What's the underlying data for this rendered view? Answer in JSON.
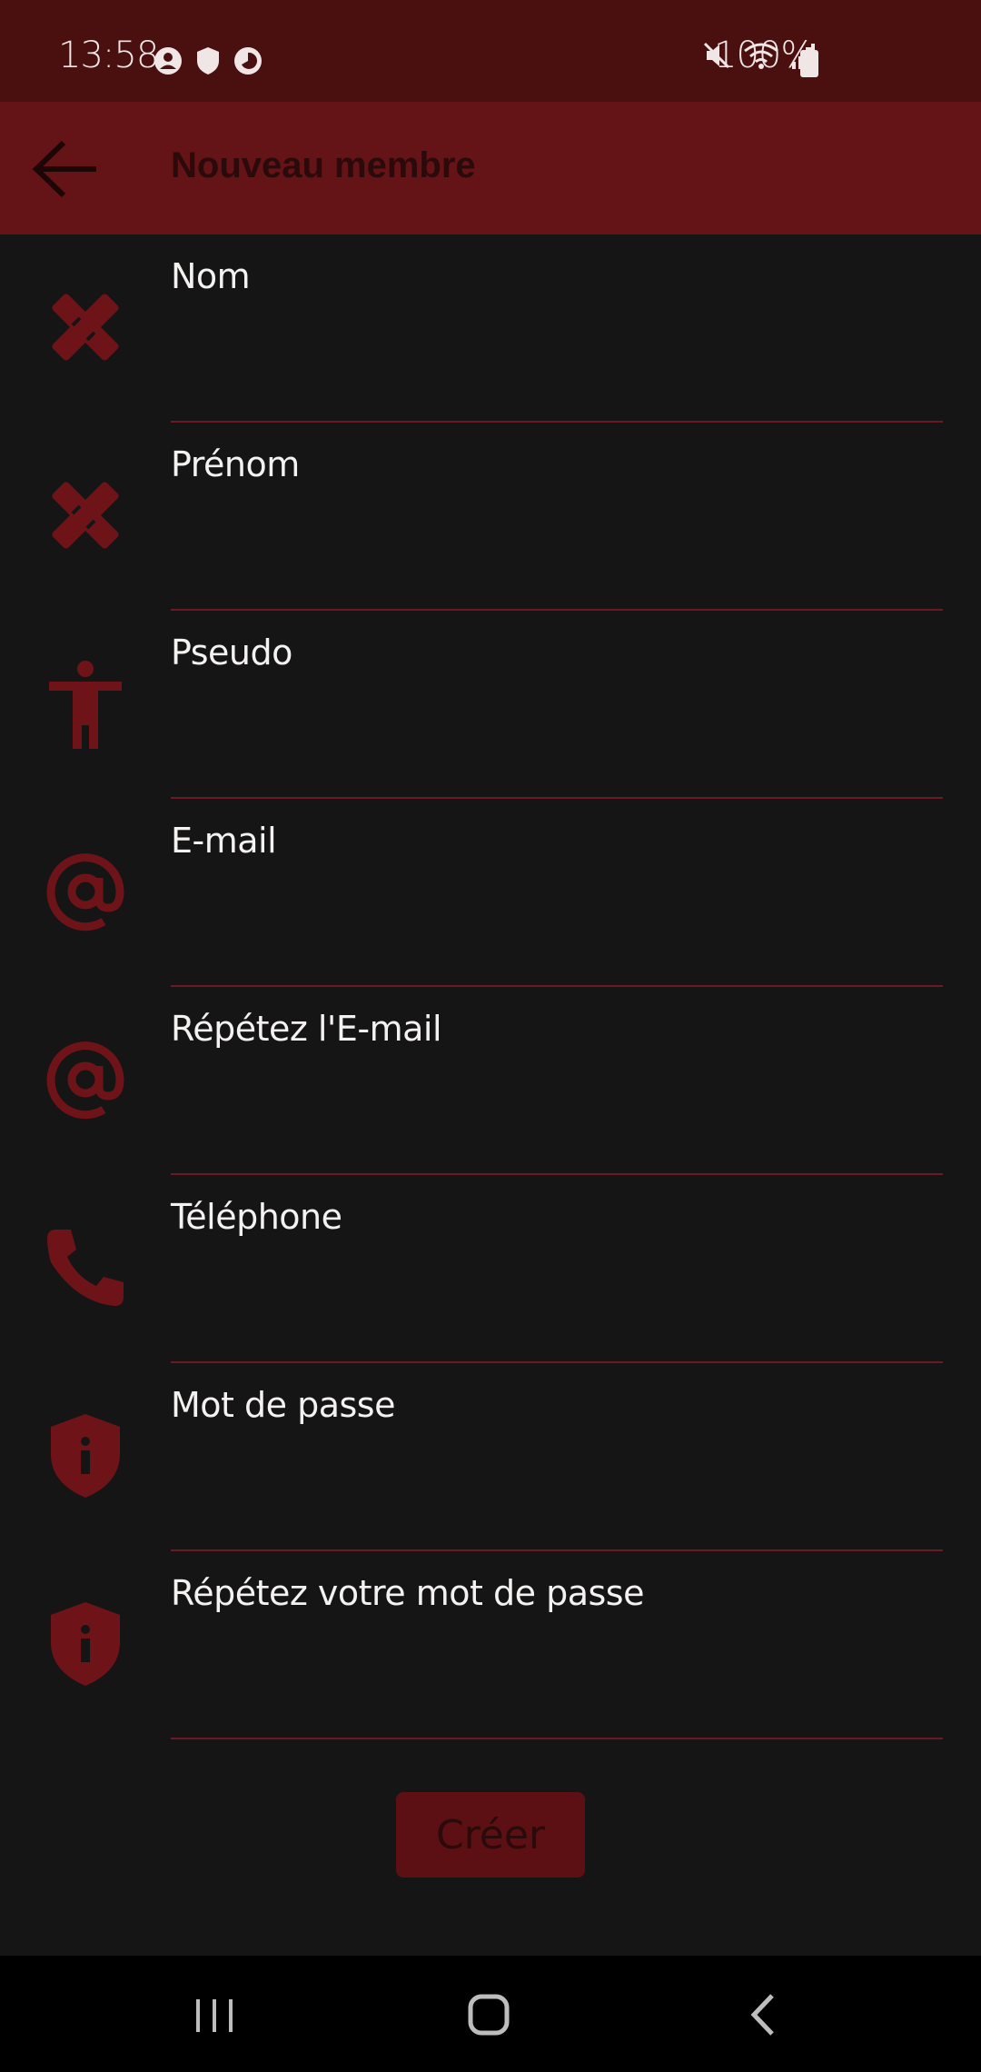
{
  "status_bar": {
    "time": "13:58",
    "battery_text": "100%",
    "left_icons": [
      "account-circle-icon",
      "shield-icon",
      "vpn-shield-icon"
    ],
    "right_icons": [
      "mute-icon",
      "wifi-icon",
      "signal-icon",
      "battery-icon"
    ]
  },
  "app_bar": {
    "title": "Nouveau membre",
    "back_icon": "arrow-left-icon"
  },
  "form": {
    "fields": [
      {
        "label": "Nom",
        "icon": "pencil-ruler-icon",
        "value": ""
      },
      {
        "label": "Prénom",
        "icon": "pencil-ruler-icon",
        "value": ""
      },
      {
        "label": "Pseudo",
        "icon": "accessibility-person-icon",
        "value": ""
      },
      {
        "label": "E-mail",
        "icon": "at-sign-icon",
        "value": ""
      },
      {
        "label": "Répétez l'E-mail",
        "icon": "at-sign-icon",
        "value": ""
      },
      {
        "label": "Téléphone",
        "icon": "phone-icon",
        "value": ""
      },
      {
        "label": "Mot de passe",
        "icon": "shield-info-icon",
        "value": ""
      },
      {
        "label": "Répétez votre mot de passe",
        "icon": "shield-info-icon",
        "value": ""
      }
    ],
    "submit_label": "Créer"
  },
  "nav_bar": {
    "buttons": [
      "recent-apps-icon",
      "home-icon",
      "back-icon"
    ]
  },
  "colors": {
    "status_bar": "#4a1010",
    "app_bar": "#641317",
    "background": "#151515",
    "accent": "#6e1419",
    "underline": "#6b1a24"
  }
}
